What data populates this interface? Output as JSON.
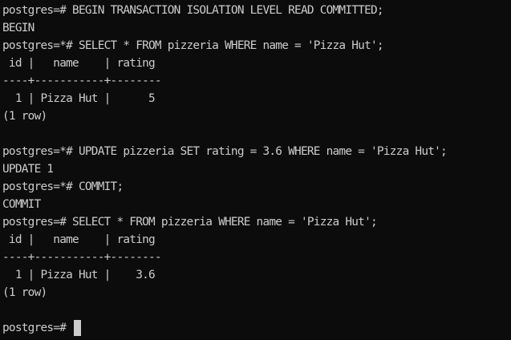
{
  "terminal": {
    "lines": [
      "postgres=# BEGIN TRANSACTION ISOLATION LEVEL READ COMMITTED;",
      "BEGIN",
      "postgres=*# SELECT * FROM pizzeria WHERE name = 'Pizza Hut';",
      " id |   name    | rating",
      "----+-----------+--------",
      "  1 | Pizza Hut |      5",
      "(1 row)",
      "",
      "postgres=*# UPDATE pizzeria SET rating = 3.6 WHERE name = 'Pizza Hut';",
      "UPDATE 1",
      "postgres=*# COMMIT;",
      "COMMIT",
      "postgres=# SELECT * FROM pizzeria WHERE name = 'Pizza Hut';",
      " id |   name    | rating",
      "----+-----------+--------",
      "  1 | Pizza Hut |    3.6",
      "(1 row)",
      "",
      "postgres=# "
    ]
  }
}
